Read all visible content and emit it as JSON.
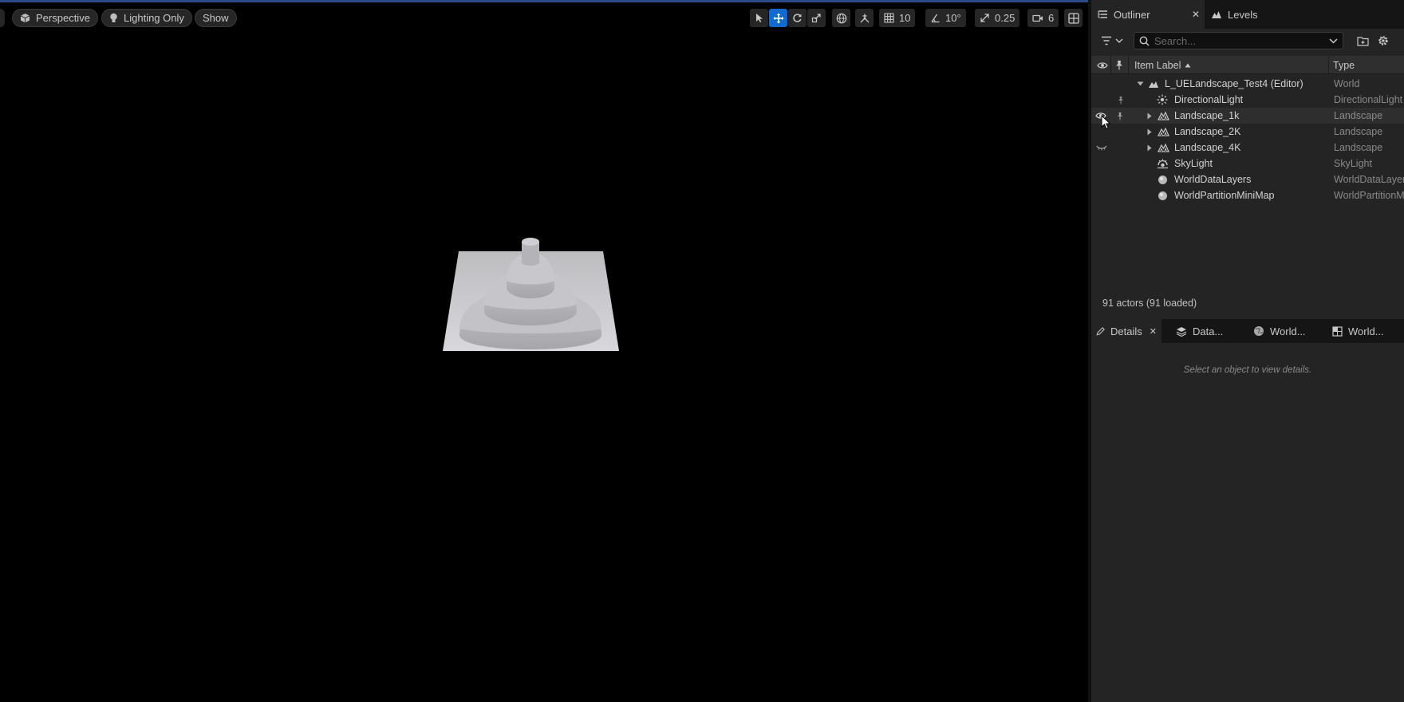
{
  "viewport": {
    "view_mode": "Perspective",
    "lighting_mode": "Lighting Only",
    "show_label": "Show",
    "grid_snap": "10",
    "rotation_snap": "10°",
    "scale_snap": "0.25",
    "camera_speed": "6"
  },
  "outliner": {
    "tab_label": "Outliner",
    "levels_tab_label": "Levels",
    "search_placeholder": "Search...",
    "col_label": "Item Label",
    "col_type": "Type",
    "rows": [
      {
        "label": "L_UELandscape_Test4 (Editor)",
        "type": "World",
        "icon": "world-icon"
      },
      {
        "label": "DirectionalLight",
        "type": "DirectionalLight",
        "icon": "sun-icon"
      },
      {
        "label": "Landscape_1k",
        "type": "Landscape",
        "icon": "landscape-icon"
      },
      {
        "label": "Landscape_2K",
        "type": "Landscape",
        "icon": "landscape-icon"
      },
      {
        "label": "Landscape_4K",
        "type": "Landscape",
        "icon": "landscape-icon"
      },
      {
        "label": "SkyLight",
        "type": "SkyLight",
        "icon": "skylight-icon"
      },
      {
        "label": "WorldDataLayers",
        "type": "WorldDataLayers",
        "icon": "sphere-icon"
      },
      {
        "label": "WorldPartitionMiniMap",
        "type": "WorldPartitionMiniMap",
        "icon": "sphere-icon"
      }
    ],
    "actor_count": "91 actors (91 loaded)"
  },
  "details": {
    "tabs": [
      "Details",
      "Data...",
      "World...",
      "World..."
    ],
    "empty_message": "Select an object to view details."
  },
  "colors": {
    "accent": "#0f6bd0",
    "panel_bg": "#242424",
    "viewport_bg": "#000000"
  }
}
